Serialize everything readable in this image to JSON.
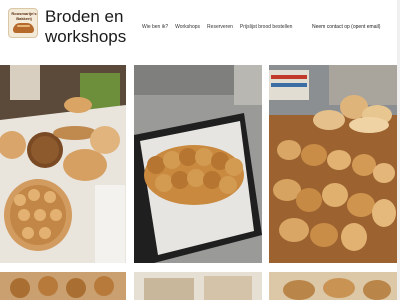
{
  "header": {
    "logo_text": "Roosmarijn's Bakkerij",
    "site_title": "Broden en workshops",
    "contact_label": "Neem contact op (opent email)"
  },
  "nav": {
    "items": [
      {
        "label": "Wie ben ik?"
      },
      {
        "label": "Workshops"
      },
      {
        "label": "Reserveren"
      },
      {
        "label": "Prijslijst brood bestellen"
      }
    ]
  },
  "gallery": {
    "photos": [
      {
        "subject": "bread-table-photo"
      },
      {
        "subject": "braided-rolls-tray-photo"
      },
      {
        "subject": "bread-rolls-cooling-rack-photo"
      }
    ]
  },
  "colors": {
    "text": "#1a1a1a",
    "crust": "#b5692b",
    "background": "#ffffff"
  }
}
